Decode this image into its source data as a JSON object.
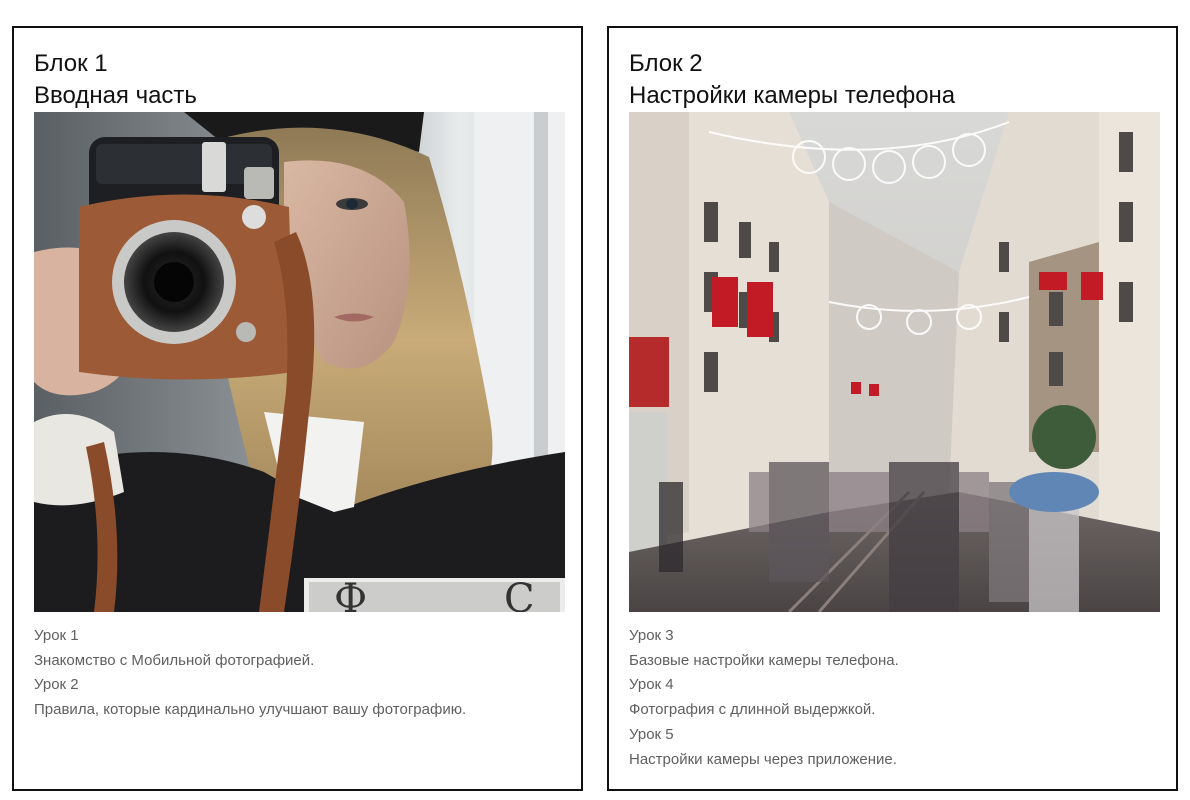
{
  "blocks": [
    {
      "block_label": "Блок 1",
      "title": "Вводная часть",
      "image": "woman-with-instax-camera-photo",
      "lessons": [
        {
          "label": "Урок 1",
          "description": "Знакомство с Мобильной фотографией."
        },
        {
          "label": "Урок 2",
          "description": "Правила, которые кардинально улучшают вашу фотографию."
        }
      ]
    },
    {
      "block_label": "Блок 2",
      "title": "Настройки камеры телефона",
      "image": "rainy-istanbul-street-long-exposure-photo",
      "lessons": [
        {
          "label": "Урок 3",
          "description": "Базовые настройки камеры телефона."
        },
        {
          "label": "Урок 4",
          "description": "Фотография с длинной выдержкой."
        },
        {
          "label": "Урок 5",
          "description": "Настройки камеры через приложение."
        }
      ]
    }
  ],
  "colors": {
    "border": "#111111",
    "heading": "#111111",
    "lesson_text": "#5f5f5f",
    "background": "#ffffff"
  }
}
